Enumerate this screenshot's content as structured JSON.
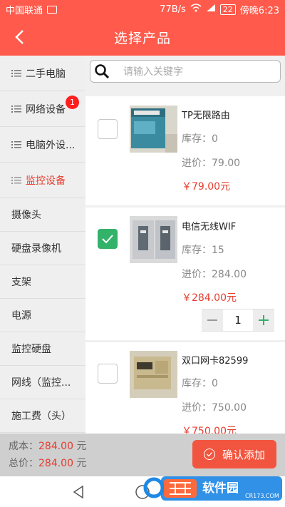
{
  "status": {
    "carrier": "中国联通",
    "speed": "77B/s",
    "battery": "22",
    "time": "傍晚6:23"
  },
  "header": {
    "title": "选择产品"
  },
  "search": {
    "placeholder": "请输入关键字"
  },
  "categories": [
    {
      "label": "二手电脑"
    },
    {
      "label": "网络设备",
      "badge": "1"
    },
    {
      "label": "电脑外设..."
    },
    {
      "label": "监控设备"
    }
  ],
  "subcategories": [
    "摄像头",
    "硬盘录像机",
    "支架",
    "电源",
    "监控硬盘",
    "网线（监控...",
    "施工费（头）"
  ],
  "products": [
    {
      "name": "TP无限路由",
      "stock": "库存：0",
      "cost": "进价：79.00",
      "price": "￥79.00元",
      "checked": false
    },
    {
      "name": "电信无线WIF",
      "stock": "库存：15",
      "cost": "进价：284.00",
      "price": "￥284.00元",
      "checked": true,
      "qty": "1"
    },
    {
      "name": "双口网卡82599",
      "stock": "库存：0",
      "cost": "进价：750.00",
      "price": "￥750.00元",
      "checked": false
    }
  ],
  "footer": {
    "cost_label": "成本：",
    "cost_value": "284.00",
    "cost_unit": "元",
    "total_label": "总价：",
    "total_value": "284.00",
    "total_unit": "元",
    "confirm_label": "确认添加"
  },
  "watermark": {
    "brand": "软件园",
    "site": "CR173.COM"
  },
  "colors": {
    "accent": "#ff5a4b",
    "price": "#e63c2e",
    "check": "#33b26a"
  }
}
